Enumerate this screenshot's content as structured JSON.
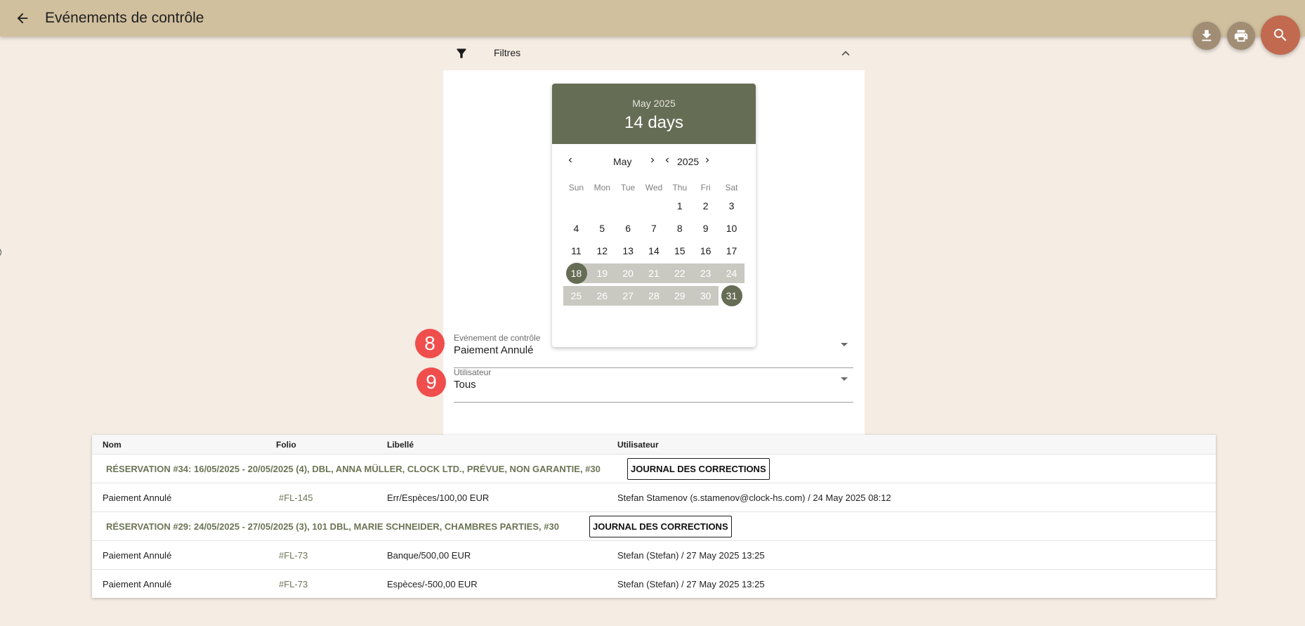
{
  "header": {
    "title": "Evénements de contrôle",
    "actions": [
      "download-icon",
      "print-icon",
      "search-icon"
    ],
    "colors": {
      "bar": "#d1c09e",
      "search_fab": "#c16a50",
      "small_fab": "#a08d74"
    }
  },
  "filters": {
    "title": "Filtres",
    "calendar": {
      "header_month": "May 2025",
      "range_label": "14 days",
      "nav_month": "May",
      "nav_year": "2025",
      "weekdays": [
        "Sun",
        "Mon",
        "Tue",
        "Wed",
        "Thu",
        "Fri",
        "Sat"
      ],
      "weeks": [
        [
          "",
          "",
          "",
          "",
          "1",
          "2",
          "3"
        ],
        [
          "4",
          "5",
          "6",
          "7",
          "8",
          "9",
          "10"
        ],
        [
          "11",
          "12",
          "13",
          "14",
          "15",
          "16",
          "17"
        ],
        [
          "18",
          "19",
          "20",
          "21",
          "22",
          "23",
          "24"
        ],
        [
          "25",
          "26",
          "27",
          "28",
          "29",
          "30",
          "31"
        ]
      ],
      "range_start": "18",
      "range_end": "31",
      "accent": "#666d55"
    },
    "event_select": {
      "label": "Evénement de contrôle",
      "value": "Paiement Annulé",
      "badge": "8"
    },
    "user_select": {
      "label": "Utilisateur",
      "value": "Tous",
      "badge": "9"
    }
  },
  "table": {
    "columns": [
      "Nom",
      "Folio",
      "Libellé",
      "Utilisateur"
    ],
    "groups": [
      {
        "title": "RÉSERVATION #34: 16/05/2025 - 20/05/2025 (4), DBL, ANNA MÜLLER, CLOCK LTD., PRÉVUE, NON GARANTIE, #30",
        "button": "JOURNAL DES CORRECTIONS",
        "rows": [
          {
            "nom": "Paiement Annulé",
            "folio": "#FL-145",
            "libelle": "Err/Espèces/100,00 EUR",
            "utilisateur": "Stefan Stamenov (s.stamenov@clock-hs.com) / 24 May 2025 08:12"
          }
        ]
      },
      {
        "title": "RÉSERVATION #29: 24/05/2025 - 27/05/2025 (3), 101 DBL, MARIE SCHNEIDER, CHAMBRES PARTIES, #30",
        "button": "JOURNAL DES CORRECTIONS",
        "rows": [
          {
            "nom": "Paiement Annulé",
            "folio": "#FL-73",
            "libelle": "Banque/500,00 EUR",
            "utilisateur": "Stefan (Stefan) / 27 May 2025 13:25"
          },
          {
            "nom": "Paiement Annulé",
            "folio": "#FL-73",
            "libelle": "Espèces/-500,00 EUR",
            "utilisateur": "Stefan (Stefan) / 27 May 2025 13:25"
          }
        ]
      }
    ]
  }
}
